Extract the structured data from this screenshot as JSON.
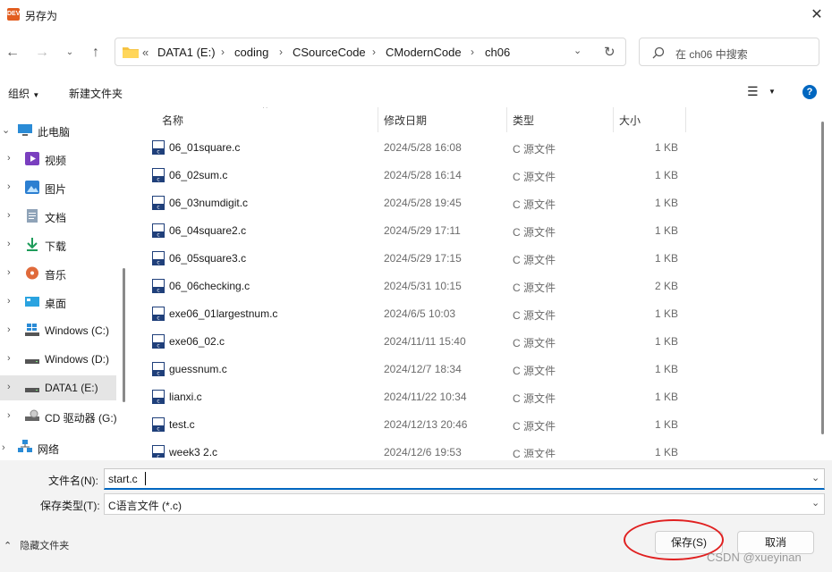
{
  "window": {
    "title": "另存为",
    "app_icon_text": "DEV"
  },
  "address": {
    "overflow": "«",
    "crumbs": [
      "DATA1 (E:)",
      "coding",
      "CSourceCode",
      "CModernCode",
      "ch06"
    ]
  },
  "search": {
    "placeholder": "在 ch06 中搜索"
  },
  "toolbar": {
    "organize": "组织",
    "new_folder": "新建文件夹"
  },
  "nav": {
    "items": [
      {
        "label": "此电脑",
        "icon": "pc-icon"
      },
      {
        "label": "视频",
        "icon": "video-icon"
      },
      {
        "label": "图片",
        "icon": "picture-icon"
      },
      {
        "label": "文档",
        "icon": "document-icon"
      },
      {
        "label": "下载",
        "icon": "download-icon"
      },
      {
        "label": "音乐",
        "icon": "music-icon"
      },
      {
        "label": "桌面",
        "icon": "desktop-icon"
      },
      {
        "label": "Windows (C:)",
        "icon": "drive-icon"
      },
      {
        "label": "Windows (D:)",
        "icon": "drive-icon"
      },
      {
        "label": "DATA1 (E:)",
        "icon": "drive-icon"
      },
      {
        "label": "CD 驱动器 (G:)",
        "icon": "cd-drive-icon"
      },
      {
        "label": "网络",
        "icon": "network-icon"
      }
    ]
  },
  "columns": {
    "name": "名称",
    "date": "修改日期",
    "type": "类型",
    "size": "大小"
  },
  "files": [
    {
      "name": "06_01square.c",
      "date": "2024/5/28 16:08",
      "type": "C 源文件",
      "size": "1 KB"
    },
    {
      "name": "06_02sum.c",
      "date": "2024/5/28 16:14",
      "type": "C 源文件",
      "size": "1 KB"
    },
    {
      "name": "06_03numdigit.c",
      "date": "2024/5/28 19:45",
      "type": "C 源文件",
      "size": "1 KB"
    },
    {
      "name": "06_04square2.c",
      "date": "2024/5/29 17:11",
      "type": "C 源文件",
      "size": "1 KB"
    },
    {
      "name": "06_05square3.c",
      "date": "2024/5/29 17:15",
      "type": "C 源文件",
      "size": "1 KB"
    },
    {
      "name": "06_06checking.c",
      "date": "2024/5/31 10:15",
      "type": "C 源文件",
      "size": "2 KB"
    },
    {
      "name": "exe06_01largestnum.c",
      "date": "2024/6/5 10:03",
      "type": "C 源文件",
      "size": "1 KB"
    },
    {
      "name": "exe06_02.c",
      "date": "2024/11/11 15:40",
      "type": "C 源文件",
      "size": "1 KB"
    },
    {
      "name": "guessnum.c",
      "date": "2024/12/7 18:34",
      "type": "C 源文件",
      "size": "1 KB"
    },
    {
      "name": "lianxi.c",
      "date": "2024/11/22 10:34",
      "type": "C 源文件",
      "size": "1 KB"
    },
    {
      "name": "test.c",
      "date": "2024/12/13 20:46",
      "type": "C 源文件",
      "size": "1 KB"
    },
    {
      "name": "week3 2.c",
      "date": "2024/12/6 19:53",
      "type": "C 源文件",
      "size": "1 KB"
    }
  ],
  "form": {
    "filename_label": "文件名(N):",
    "filename_value": "start.c",
    "filetype_label": "保存类型(T):",
    "filetype_value": "C语言文件 (*.c)"
  },
  "footer": {
    "hide_folders": "隐藏文件夹",
    "save": "保存(S)",
    "cancel": "取消",
    "watermark": "CSDN @xueyinan"
  },
  "colors": {
    "accent": "#0067c0",
    "highlight": "#e02020",
    "selected_nav": "#e5e5e5"
  }
}
